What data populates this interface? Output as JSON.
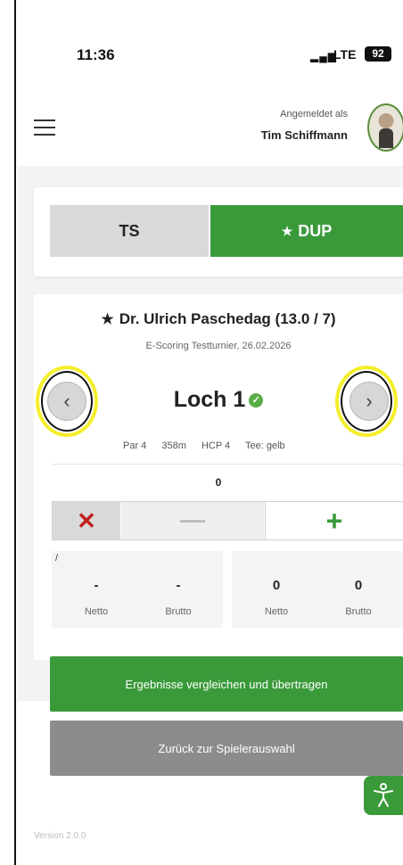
{
  "status": {
    "time": "11:36",
    "network": "LTE",
    "battery": "92",
    "signal_icon": "signal-bars-icon"
  },
  "header": {
    "menu_icon": "hamburger-menu-icon",
    "login_label": "Angemeldet als",
    "user_name": "Tim Schiffmann"
  },
  "tabs": [
    {
      "label": "TS",
      "active": false
    },
    {
      "label": "DUP",
      "active": true,
      "icon": "star-icon"
    }
  ],
  "player": {
    "name": "Dr. Ulrich Paschedag (13.0 / 7)",
    "tournament": "E-Scoring Testturnier, 26.02.2026"
  },
  "hole": {
    "title": "Loch 1",
    "status_icon": "check-circle-icon",
    "par": "Par 4",
    "distance": "358m",
    "hcp": "HCP 4",
    "tee": "Tee: gelb",
    "strokes": "0"
  },
  "stepper": {
    "clear": "✕",
    "plus": "+"
  },
  "scores": {
    "left": {
      "marker": "/",
      "netto_value": "-",
      "brutto_value": "-",
      "netto_label": "Netto",
      "brutto_label": "Brutto"
    },
    "right": {
      "netto_value": "0",
      "brutto_value": "0",
      "netto_label": "Netto",
      "brutto_label": "Brutto"
    }
  },
  "actions": {
    "compare": "Ergebnisse vergleichen und übertragen",
    "back": "Zurück zur Spielerauswahl"
  },
  "accessibility": {
    "icon": "accessibility-icon"
  },
  "footer": {
    "version": "Version 2.0.0"
  },
  "colors": {
    "primary_green": "#3a9a3a",
    "grey_button": "#8c8c8c",
    "danger_red": "#c41e1e",
    "highlight_yellow": "#f4ef2a"
  }
}
